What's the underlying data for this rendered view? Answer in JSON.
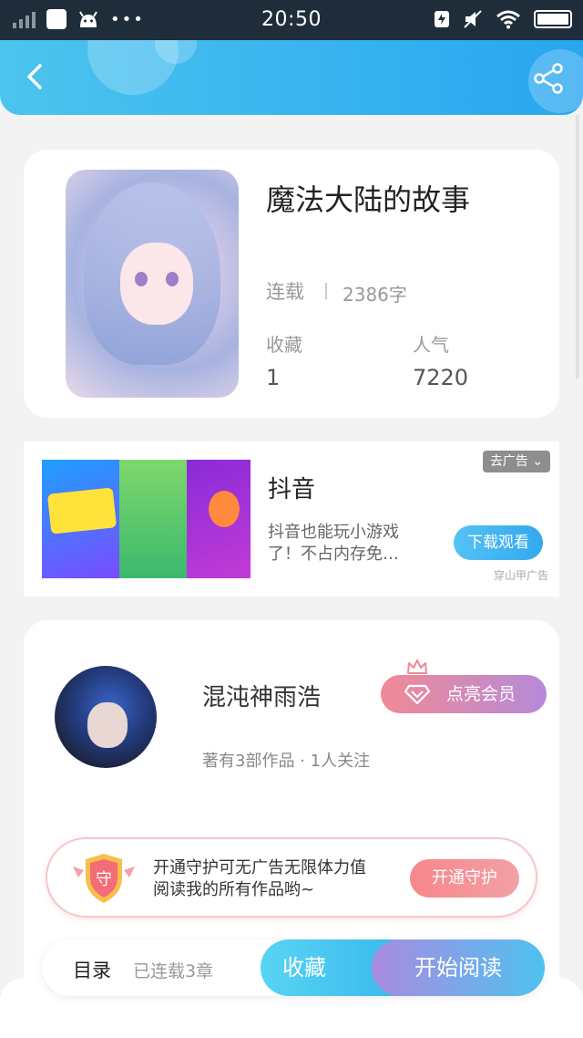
{
  "status_bar": {
    "time": "20:50",
    "dots": "•••"
  },
  "book": {
    "title": "魔法大陆的故事",
    "status": "连载",
    "word_count": "2386字",
    "favorites_label": "收藏",
    "favorites_value": "1",
    "popularity_label": "人气",
    "popularity_value": "7220"
  },
  "ad": {
    "title": "抖音",
    "description": "抖音也能玩小游戏了！不占内存免…",
    "remove_label": "去广告 ⌄",
    "download_label": "下载观看",
    "source": "穿山甲广告"
  },
  "author": {
    "name": "混沌神雨浩",
    "meta": "著有3部作品 · 1人关注",
    "vip_label": "点亮会员"
  },
  "guard": {
    "text": "开通守护可无广告无限体力值阅读我的所有作品哟~",
    "shield_char": "守",
    "button_label": "开通守护"
  },
  "bottom": {
    "toc_label": "目录",
    "chapters": "已连载3章",
    "favorite_label": "收藏",
    "read_label": "开始阅读"
  },
  "colors": {
    "header": "#28a6f0",
    "accent": "#4fc1ef",
    "vip": "#f18a96"
  },
  "icons": [
    "back-icon",
    "share-icon",
    "crown-icon",
    "gem-icon",
    "shield-icon"
  ]
}
